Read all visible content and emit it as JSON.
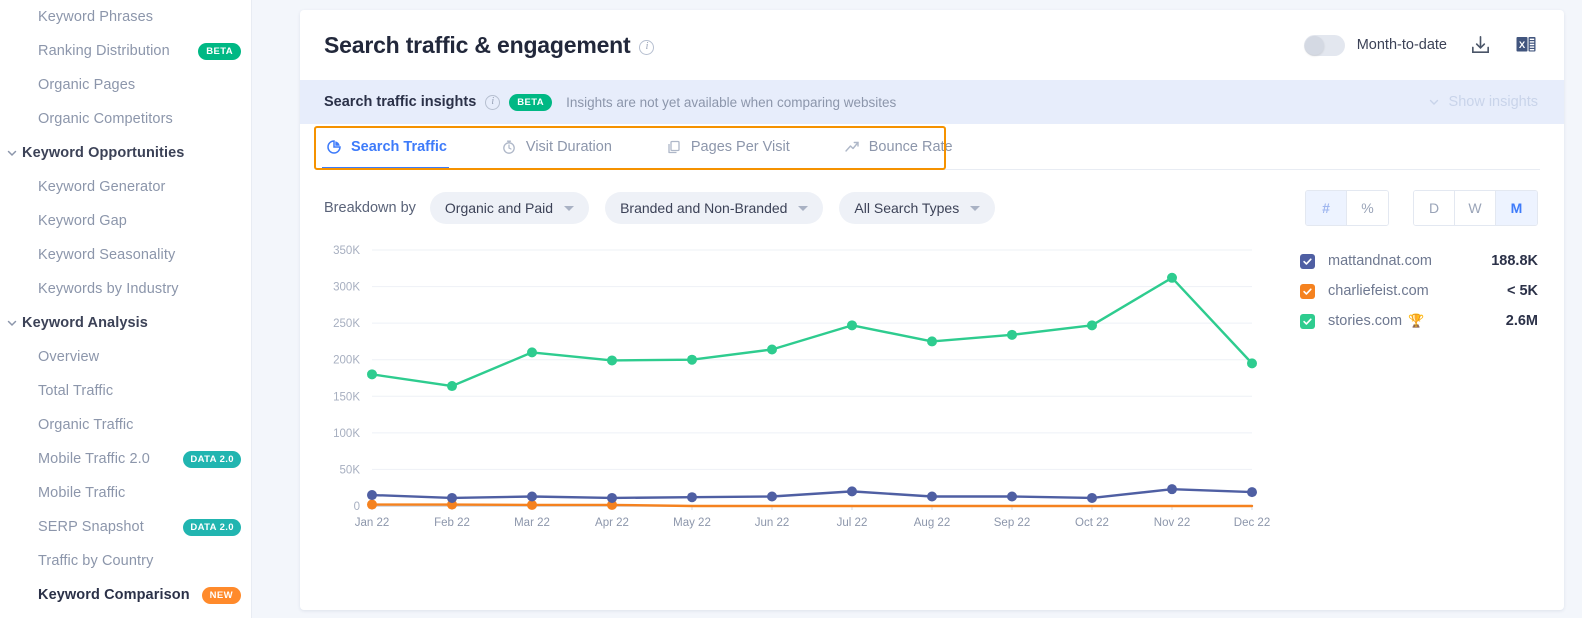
{
  "sidebar": {
    "items": [
      {
        "label": "Keyword Phrases",
        "type": "item"
      },
      {
        "label": "Ranking Distribution",
        "type": "item",
        "badge": "BETA",
        "badge_kind": "beta"
      },
      {
        "label": "Organic Pages",
        "type": "item"
      },
      {
        "label": "Organic Competitors",
        "type": "item"
      },
      {
        "label": "Keyword Opportunities",
        "type": "group"
      },
      {
        "label": "Keyword Generator",
        "type": "item"
      },
      {
        "label": "Keyword Gap",
        "type": "item"
      },
      {
        "label": "Keyword Seasonality",
        "type": "item"
      },
      {
        "label": "Keywords by Industry",
        "type": "item"
      },
      {
        "label": "Keyword Analysis",
        "type": "group"
      },
      {
        "label": "Overview",
        "type": "item"
      },
      {
        "label": "Total Traffic",
        "type": "item"
      },
      {
        "label": "Organic Traffic",
        "type": "item"
      },
      {
        "label": "Mobile Traffic 2.0",
        "type": "item",
        "badge": "DATA 2.0",
        "badge_kind": "data"
      },
      {
        "label": "Mobile Traffic",
        "type": "item"
      },
      {
        "label": "SERP Snapshot",
        "type": "item",
        "badge": "DATA 2.0",
        "badge_kind": "data"
      },
      {
        "label": "Traffic by Country",
        "type": "item"
      },
      {
        "label": "Keyword Comparison",
        "type": "bold-item",
        "badge": "NEW",
        "badge_kind": "new"
      }
    ]
  },
  "header": {
    "title": "Search traffic & engagement",
    "info_icon": "info-icon",
    "toggle_label": "Month-to-date",
    "toggle_state": "off",
    "download_icon": "download-icon",
    "excel_icon": "excel-export-icon"
  },
  "insight_bar": {
    "title": "Search traffic insights",
    "info_icon": "info-icon",
    "badge": "BETA",
    "message": "Insights are not yet available when comparing websites",
    "show_insights_label": "Show insights",
    "chevron_icon": "chevron-down-icon"
  },
  "tabs": [
    {
      "label": "Search Traffic",
      "icon": "pie-chart-icon",
      "active": true
    },
    {
      "label": "Visit Duration",
      "icon": "stopwatch-icon",
      "active": false
    },
    {
      "label": "Pages Per Visit",
      "icon": "pages-stack-icon",
      "active": false
    },
    {
      "label": "Bounce Rate",
      "icon": "trend-line-icon",
      "active": false
    }
  ],
  "controls": {
    "breakdown_label": "Breakdown by",
    "dropdowns": [
      {
        "value": "Organic and Paid",
        "icon": "caret-down-icon"
      },
      {
        "value": "Branded and Non-Branded",
        "icon": "caret-down-icon"
      },
      {
        "value": "All Search Types",
        "icon": "caret-down-icon"
      }
    ],
    "unit_segment": {
      "options": [
        "#",
        "%"
      ],
      "selected": "#"
    },
    "period_segment": {
      "options": [
        "D",
        "W",
        "M"
      ],
      "selected": "M"
    }
  },
  "legend": [
    {
      "name": "mattandnat.com",
      "value": "188.8K",
      "color": "#4f5fa3",
      "checked": true,
      "trophy": false
    },
    {
      "name": "charliefeist.com",
      "value": "< 5K",
      "color": "#f5821f",
      "checked": true,
      "trophy": false
    },
    {
      "name": "stories.com",
      "value": "2.6M",
      "color": "#2ecc8f",
      "checked": true,
      "trophy": true,
      "trophy_icon": "🏆"
    }
  ],
  "chart_data": {
    "type": "line",
    "title": "Search traffic & engagement",
    "xlabel": "",
    "ylabel": "",
    "ylim": [
      0,
      350000
    ],
    "grid": true,
    "legend_position": "right",
    "categories": [
      "Jan 22",
      "Feb 22",
      "Mar 22",
      "Apr 22",
      "May 22",
      "Jun 22",
      "Jul 22",
      "Aug 22",
      "Sep 22",
      "Oct 22",
      "Nov 22",
      "Dec 22"
    ],
    "ytick_labels": [
      "0",
      "50K",
      "100K",
      "150K",
      "200K",
      "250K",
      "300K",
      "350K"
    ],
    "ytick_values": [
      0,
      50000,
      100000,
      150000,
      200000,
      250000,
      300000,
      350000
    ],
    "series": [
      {
        "name": "stories.com",
        "color": "#2ecc8f",
        "values": [
          180000,
          164000,
          210000,
          199000,
          200000,
          214000,
          247000,
          225000,
          234000,
          247000,
          312000,
          195000
        ]
      },
      {
        "name": "mattandnat.com",
        "color": "#4f5fa3",
        "values": [
          15000,
          11000,
          13000,
          11000,
          12000,
          13000,
          20000,
          13000,
          13000,
          11000,
          23000,
          19000
        ]
      },
      {
        "name": "charliefeist.com",
        "color": "#f5821f",
        "values": [
          2000,
          2000,
          1500,
          1500,
          0,
          0,
          0,
          0,
          0,
          0,
          0,
          0
        ]
      }
    ]
  }
}
